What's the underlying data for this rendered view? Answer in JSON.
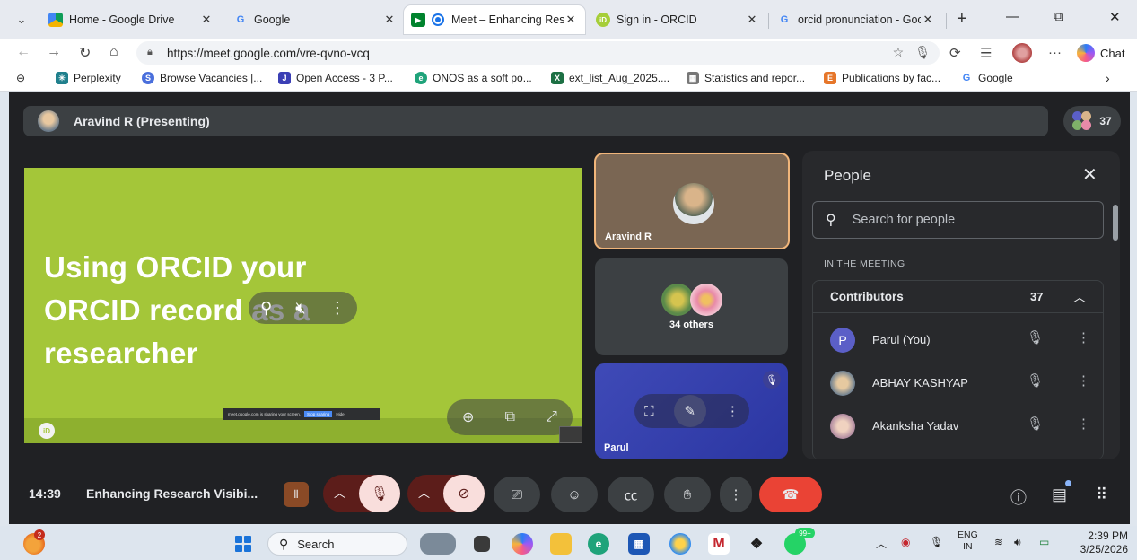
{
  "browser": {
    "tabs": [
      {
        "label": "Home - Google Drive",
        "favicon": "google-drive-icon",
        "active": false
      },
      {
        "label": "Google",
        "favicon": "google-g-icon",
        "active": false
      },
      {
        "label": "Meet – Enhancing Rese",
        "favicon": "google-meet-icon",
        "active": true
      },
      {
        "label": "Sign in - ORCID",
        "favicon": "orcid-icon",
        "active": false
      },
      {
        "label": "orcid pronunciation - Goog",
        "favicon": "google-g-icon",
        "active": false
      }
    ],
    "url": "https://meet.google.com/vre-qvno-vcq",
    "chat_label": "Chat",
    "bookmarks": [
      {
        "label": "Perplexity",
        "icon": "perplexity-icon",
        "color": "#20808d"
      },
      {
        "label": "Browse Vacancies |...",
        "icon": "vacancies-icon",
        "color": "#4a6fdc"
      },
      {
        "label": "Open Access - 3 P...",
        "icon": "jstor-icon",
        "color": "#3b3fb5"
      },
      {
        "label": "ONOS as a soft po...",
        "icon": "edge-icon",
        "color": "#1fa37a"
      },
      {
        "label": "ext_list_Aug_2025....",
        "icon": "excel-icon",
        "color": "#1d7044"
      },
      {
        "label": "Statistics and repor...",
        "icon": "stats-icon",
        "color": "#777777"
      },
      {
        "label": "Publications by fac...",
        "icon": "publications-icon",
        "color": "#e6762a"
      },
      {
        "label": "Google",
        "icon": "google-g-icon",
        "color": "#4285f4"
      }
    ]
  },
  "meet": {
    "presenter_bar": "Aravind R (Presenting)",
    "participant_count": "37",
    "slide": {
      "lines": [
        "Using ORCID your",
        "ORCID  record as a",
        "researcher"
      ],
      "logo_text": "iD",
      "share_banner": "meet.google.com is sharing your screen.",
      "share_stop": "Stop sharing",
      "share_hide": "Hide"
    },
    "tiles": {
      "presenter_name": "Aravind R",
      "others_label": "34 others",
      "self_name": "Parul"
    },
    "people_panel": {
      "title": "People",
      "search_placeholder": "Search for people",
      "section_label": "IN THE MEETING",
      "group_name": "Contributors",
      "group_count": "37",
      "rows": [
        {
          "name": "Parul (You)",
          "initial": "P",
          "color": "#5b5fc7"
        },
        {
          "name": "ABHAY KASHYAP",
          "initial": "",
          "color": "#6d7f90"
        },
        {
          "name": "Akanksha Yadav",
          "initial": "",
          "color": "#b08aa0"
        }
      ]
    },
    "controls": {
      "time": "14:39",
      "meeting_name": "Enhancing Research Visibi..."
    }
  },
  "taskbar": {
    "weather_badge": "2",
    "search_label": "Search",
    "whatsapp_badge": "99+",
    "lang_top": "ENG",
    "lang_bottom": "IN",
    "time": "2:39 PM",
    "date": "3/25/2026"
  }
}
